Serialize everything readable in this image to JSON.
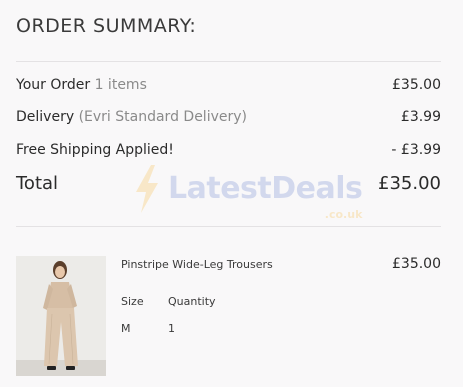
{
  "summary": {
    "title": "ORDER SUMMARY:",
    "your_order_label": "Your Order",
    "your_order_count": "1 items",
    "your_order_value": "£35.00",
    "delivery_label": "Delivery",
    "delivery_method": "(Evri Standard Delivery)",
    "delivery_value": "£3.99",
    "free_shipping_label": "Free Shipping Applied!",
    "free_shipping_value": "- £3.99",
    "total_label": "Total",
    "total_value": "£35.00"
  },
  "watermark": {
    "text": "LatestDeals",
    "domain": ".co.uk"
  },
  "item": {
    "name": "Pinstripe Wide-Leg Trousers",
    "price": "£35.00",
    "size_label": "Size",
    "size_value": "M",
    "quantity_label": "Quantity",
    "quantity_value": "1"
  },
  "colors": {
    "background": "#f9f8f9",
    "text": "#2b2b2b",
    "muted": "#8a8a8a",
    "divider": "#e4e2e4"
  }
}
